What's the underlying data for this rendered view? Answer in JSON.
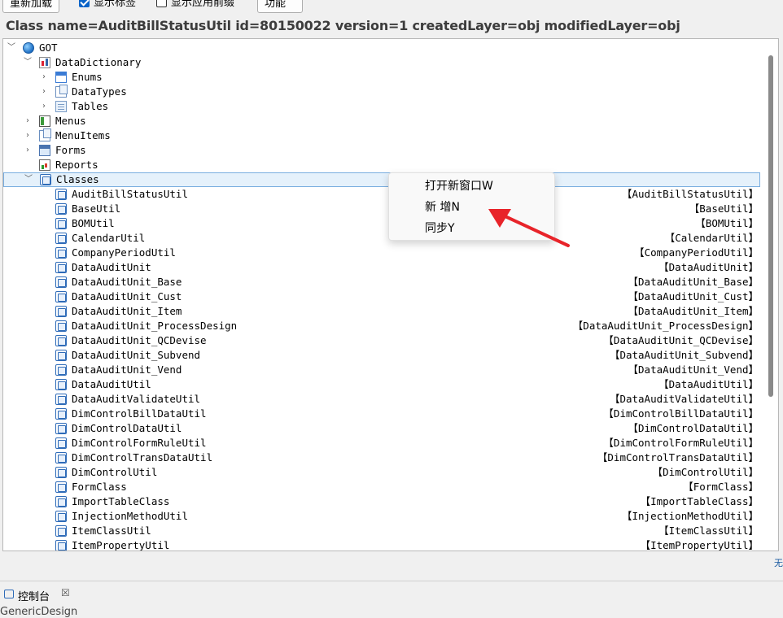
{
  "toolbar": {
    "reload_label": "重新加载",
    "show_label_check": "显示标签",
    "show_label_checked": true,
    "show_prefix_check": "显示应用前缀",
    "show_prefix_checked": false,
    "function_label": "功能"
  },
  "class_info": "Class name=AuditBillStatusUtil id=80150022 version=1 createdLayer=obj modifiedLayer=obj",
  "tree": {
    "root": "GOT",
    "data_dictionary": "DataDictionary",
    "enums": "Enums",
    "data_types": "DataTypes",
    "tables": "Tables",
    "menus": "Menus",
    "menu_items": "MenuItems",
    "forms": "Forms",
    "reports": "Reports",
    "classes": "Classes",
    "class_items": [
      {
        "name": "AuditBillStatusUtil",
        "label": "【AuditBillStatusUtil】"
      },
      {
        "name": "BaseUtil",
        "label": "【BaseUtil】"
      },
      {
        "name": "BOMUtil",
        "label": "【BOMUtil】"
      },
      {
        "name": "CalendarUtil",
        "label": "【CalendarUtil】"
      },
      {
        "name": "CompanyPeriodUtil",
        "label": "【CompanyPeriodUtil】"
      },
      {
        "name": "DataAuditUnit",
        "label": "【DataAuditUnit】"
      },
      {
        "name": "DataAuditUnit_Base",
        "label": "【DataAuditUnit_Base】"
      },
      {
        "name": "DataAuditUnit_Cust",
        "label": "【DataAuditUnit_Cust】"
      },
      {
        "name": "DataAuditUnit_Item",
        "label": "【DataAuditUnit_Item】"
      },
      {
        "name": "DataAuditUnit_ProcessDesign",
        "label": "【DataAuditUnit_ProcessDesign】"
      },
      {
        "name": "DataAuditUnit_QCDevise",
        "label": "【DataAuditUnit_QCDevise】"
      },
      {
        "name": "DataAuditUnit_Subvend",
        "label": "【DataAuditUnit_Subvend】"
      },
      {
        "name": "DataAuditUnit_Vend",
        "label": "【DataAuditUnit_Vend】"
      },
      {
        "name": "DataAuditUtil",
        "label": "【DataAuditUtil】"
      },
      {
        "name": "DataAuditValidateUtil",
        "label": "【DataAuditValidateUtil】"
      },
      {
        "name": "DimControlBillDataUtil",
        "label": "【DimControlBillDataUtil】"
      },
      {
        "name": "DimControlDataUtil",
        "label": "【DimControlDataUtil】"
      },
      {
        "name": "DimControlFormRuleUtil",
        "label": "【DimControlFormRuleUtil】"
      },
      {
        "name": "DimControlTransDataUtil",
        "label": "【DimControlTransDataUtil】"
      },
      {
        "name": "DimControlUtil",
        "label": "【DimControlUtil】"
      },
      {
        "name": "FormClass",
        "label": "【FormClass】"
      },
      {
        "name": "ImportTableClass",
        "label": "【ImportTableClass】"
      },
      {
        "name": "InjectionMethodUtil",
        "label": "【InjectionMethodUtil】"
      },
      {
        "name": "ItemClassUtil",
        "label": "【ItemClassUtil】"
      },
      {
        "name": "ItemPropertyUtil",
        "label": "【ItemPropertyUtil】"
      }
    ]
  },
  "context_menu": {
    "open_new_window": "打开新窗口W",
    "new": "新 增N",
    "sync": "同步Y"
  },
  "bottom": {
    "console_tab": "控制台",
    "console_close": "☒",
    "cut_text": "GenericDesign",
    "side_link": "无"
  },
  "colors": {
    "selection_bg": "#e5f1fb",
    "selection_border": "#7aaee0",
    "arrow": "#e8242a"
  }
}
